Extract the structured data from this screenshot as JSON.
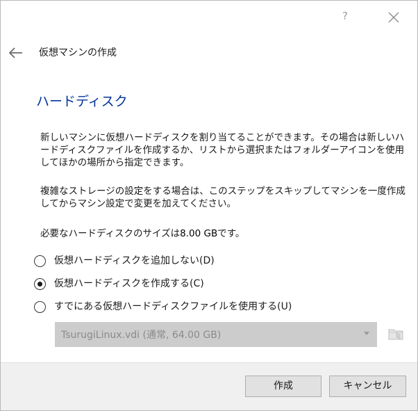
{
  "titlebar": {
    "help_label": "?",
    "help_icon": "question-mark-icon",
    "close_icon": "close-icon"
  },
  "header": {
    "back_icon": "back-arrow-icon",
    "title": "仮想マシンの作成"
  },
  "page": {
    "heading": "ハードディスク",
    "paragraph1": "新しいマシンに仮想ハードディスクを割り当てることができます。その場合は新しいハードディスクファイルを作成するか、リストから選択またはフォルダーアイコンを使用してほかの場所から指定できます。",
    "paragraph2": "複雑なストレージの設定をする場合は、このステップをスキップしてマシンを一度作成してからマシン設定で変更を加えてください。",
    "size_prefix": "必要なハードディスクのサイズは",
    "size_value": "8.00 GB",
    "size_suffix": "です。"
  },
  "options": [
    {
      "label": "仮想ハードディスクを追加しない(D)",
      "selected": false
    },
    {
      "label": "仮想ハードディスクを作成する(C)",
      "selected": true
    },
    {
      "label": "すでにある仮想ハードディスクファイルを使用する(U)",
      "selected": false
    }
  ],
  "file_select": {
    "value": "TsurugiLinux.vdi (通常, 64.00 GB)",
    "enabled": false,
    "browse_icon": "folder-icon"
  },
  "footer": {
    "create_label": "作成",
    "cancel_label": "キャンセル"
  },
  "colors": {
    "heading": "#003399",
    "footer_bg": "#f0f0f0",
    "disabled_field": "#cccccc",
    "button_bg": "#e1e1e1"
  }
}
